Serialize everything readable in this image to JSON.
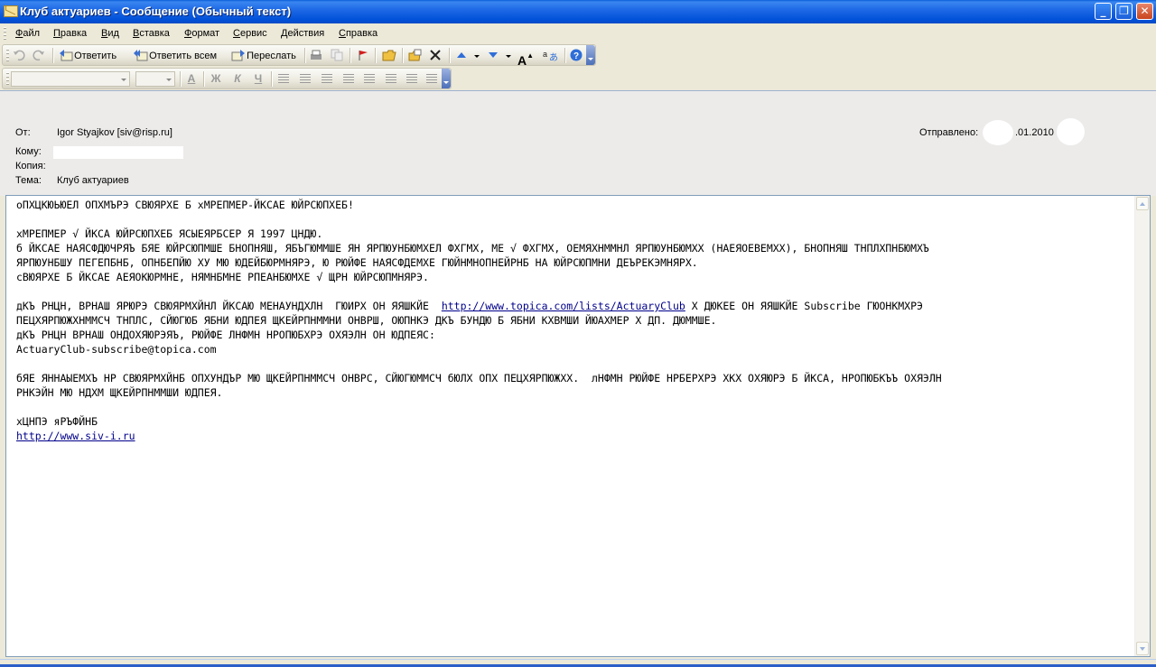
{
  "window": {
    "title": "Клуб актуариев - Сообщение (Обычный текст)",
    "minimize": "_",
    "maximize": "❐",
    "close": "✕"
  },
  "menu": [
    "Файл",
    "Правка",
    "Вид",
    "Вставка",
    "Формат",
    "Сервис",
    "Действия",
    "Справка"
  ],
  "toolbar": {
    "reply": "Ответить",
    "reply_all": "Ответить всем",
    "forward": "Переслать",
    "icons": [
      "undo-icon",
      "redo-icon",
      "reply-icon",
      "reply-all-icon",
      "forward-icon",
      "print-icon",
      "copy-icon",
      "flag-icon",
      "folder-icon",
      "move-icon",
      "delete-icon",
      "previous-item-icon",
      "next-item-icon",
      "font-size-icon",
      "translate-icon",
      "help-icon"
    ]
  },
  "header": {
    "from_label": "От:",
    "from_value": "Igor Styajkov [siv@risp.ru]",
    "to_label": "Кому:",
    "to_value": "",
    "cc_label": "Копия:",
    "subject_label": "Тема:",
    "subject_value": "Клуб актуариев",
    "sent_label": "Отправлено:",
    "sent_value": ".01.2010"
  },
  "body": {
    "line1": "оПХЦКЮЬЮЕЛ ОПХМЪРЭ СВЮЯРХЕ Б хМРЕПМЕР-ЙКСАЕ ЮЙРСЮПХЕБ!",
    "line2": "хМРЕПМЕР √ ЙКСА ЮЙРСЮПХЕБ ЯСЫЕЯРБСЕР Я 1997 ЦНДЮ.",
    "line3": "б ЙКСАЕ НАЯСФДЮЧРЯЪ БЯЕ ЮЙРСЮПМШЕ БНОПНЯШ, ЯБЪГЮММШЕ ЯН ЯРПЮУНБЮМХЕЛ ФХГМХ, МЕ √ ФХГМХ, ОЕМЯХНММНЛ ЯРПЮУНБЮМХХ (НАЕЯОЕВЕМХХ), БНОПНЯШ ТНПЛХПНБЮМХЪ",
    "line4": "ЯРПЮУНБШУ ПЕГЕПБНБ, ОПНБЕПЙЮ ХУ МЮ ЮДЕЙБЮРМНЯРЭ, Ю РЮЙФЕ НАЯСФДЕМХЕ ГЮЙНМНОПНЕЙРНБ НА ЮЙРСЮПМНИ ДЕЪРЕКЭМНЯРХ.",
    "line5": "сВЮЯРХЕ Б ЙКСАЕ АЕЯОКЮРМНЕ, НЯМНБМНЕ РПЕАНБЮМХЕ √ ЩРН ЮЙРСЮПМНЯРЭ.",
    "line6_a": "дКЪ РНЦН, ВРНАШ ЯРЮРЭ СВЮЯРМХЙНЛ ЙКСАЮ МЕНАУНДХЛН  ГЮИРХ ОН ЯЯШКЙЕ  ",
    "line6_link": "http://www.topica.com/lists/ActuaryClub",
    "line6_b": " Х ДЮКЕЕ ОН ЯЯШКЙЕ Subscribe ГЮОНКМХРЭ",
    "line7": "ПЕЦХЯРПЮЖХНММСЧ ТНПЛС, СЙЮГЮБ ЯБНИ ЮДПЕЯ ЩКЕЙРПНММНИ ОНВРШ, ОЮПНКЭ ДКЪ БУНДЮ Б ЯБНИ КХВМШИ ЙЮАХМЕР Х ДП. ДЮММШЕ.",
    "line8": "дКЪ РНЦН ВРНАШ ОНДОХЯЮРЭЯЪ, РЮЙФЕ ЛНФМН НРОПЮБХРЭ ОХЯЭЛН ОН ЮДПЕЯС:",
    "line9": "ActuaryClub-subscribe@topica.com",
    "line10": "бЯЕ ЯННАЫЕМХЪ НР СВЮЯРМХЙНБ ОПХУНДЪР МЮ ЩКЕЙРПНММСЧ ОНВРС, СЙЮГЮММСЧ бЮЛХ ОПХ ПЕЦХЯРПЮЖХХ.  лНФМН РЮЙФЕ НРБЕРХРЭ ХКХ ОХЯЮРЭ Б ЙКСА, НРОПЮБКЪЪ ОХЯЭЛН",
    "line11": "РНКЭЙН МЮ НДХМ ЩКЕЙРПНММШИ ЮДПЕЯ.",
    "line12": "хЦНПЭ яРЪФЙНБ",
    "line13_link": "http://www.siv-i.ru"
  }
}
